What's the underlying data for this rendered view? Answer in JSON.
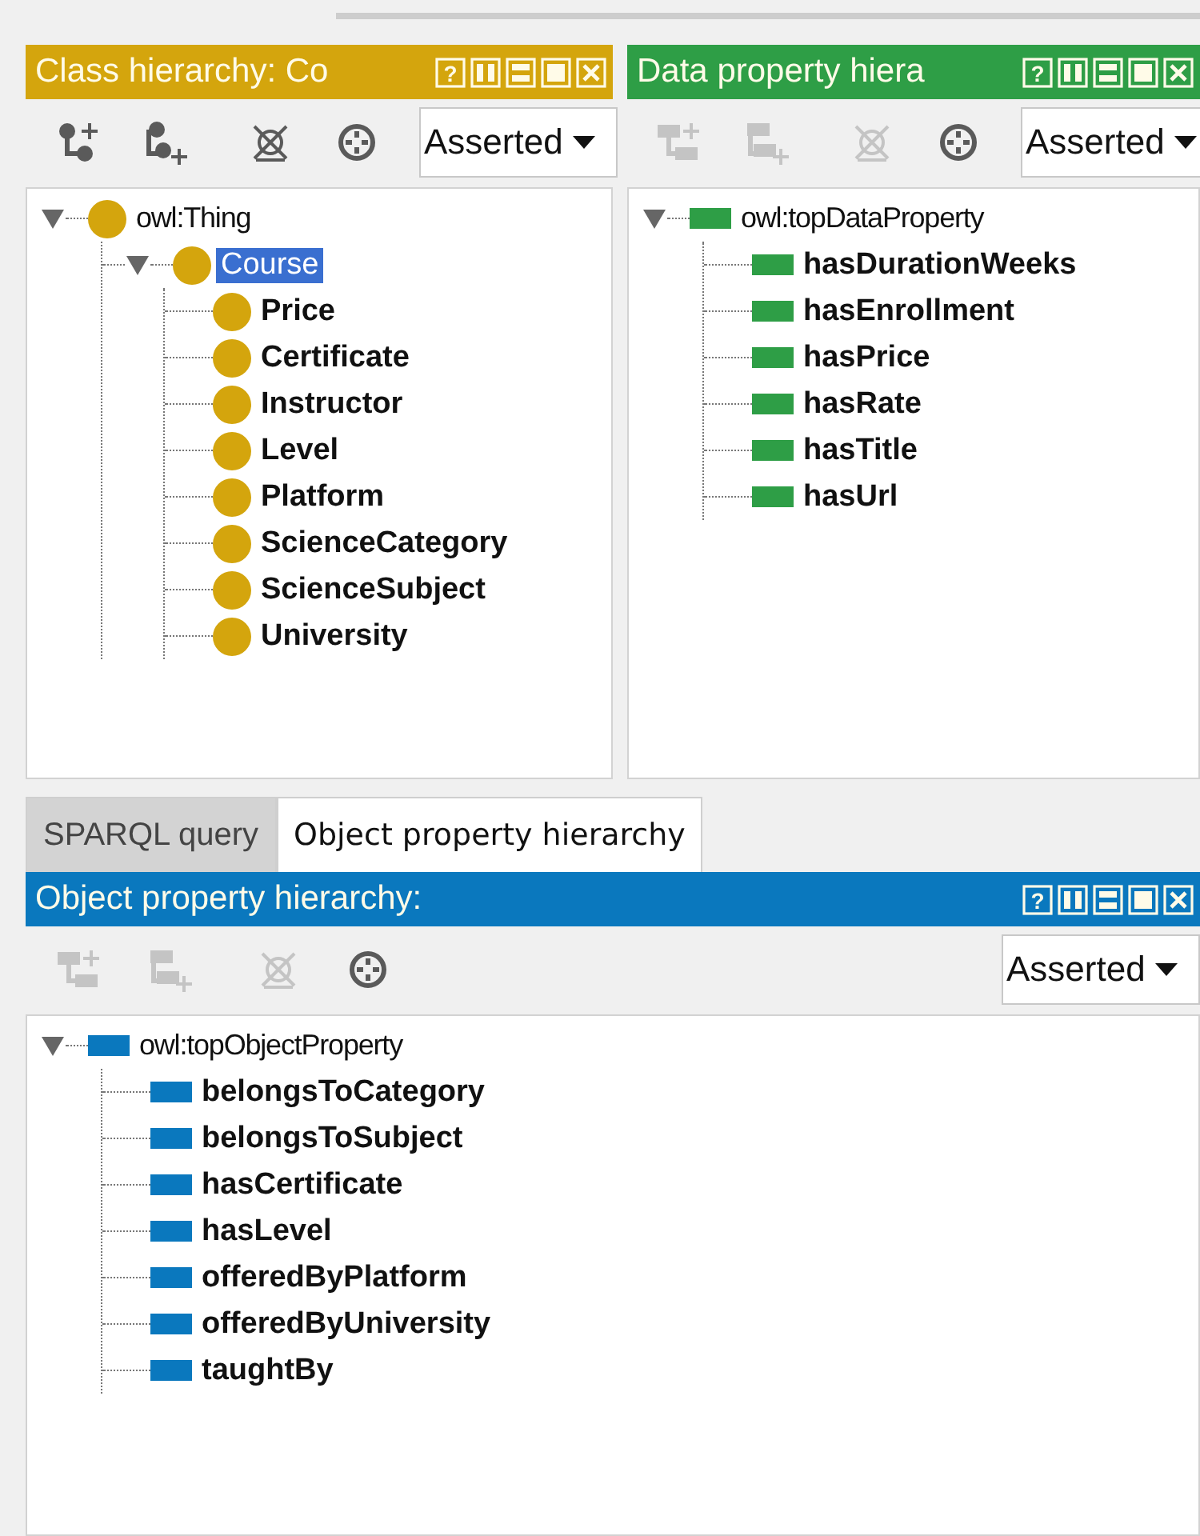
{
  "top_panels": [
    {
      "kind": "class",
      "title": "Class hierarchy: Co",
      "color": "#d4a50d",
      "help_symbol": "?",
      "view": "Asserted",
      "tools": [
        {
          "kind": "add_child",
          "disabled": false
        },
        {
          "kind": "add_sibling",
          "disabled": false
        },
        {
          "kind": "delete",
          "disabled": false
        },
        {
          "kind": "find",
          "disabled": false
        }
      ],
      "tree": [
        {
          "label": "owl:Thing",
          "bold": false,
          "selected": false,
          "expanded": true,
          "children": [
            {
              "label": "Course",
              "bold": false,
              "selected": true,
              "expanded": true,
              "children": [
                {
                  "label": "Price",
                  "bold": true,
                  "selected": false
                },
                {
                  "label": "Certificate",
                  "bold": true,
                  "selected": false
                },
                {
                  "label": "Instructor",
                  "bold": true,
                  "selected": false
                },
                {
                  "label": "Level",
                  "bold": true,
                  "selected": false
                },
                {
                  "label": "Platform",
                  "bold": true,
                  "selected": false
                },
                {
                  "label": "ScienceCategory",
                  "bold": true,
                  "selected": false
                },
                {
                  "label": "ScienceSubject",
                  "bold": true,
                  "selected": false
                },
                {
                  "label": "University",
                  "bold": true,
                  "selected": false
                }
              ]
            }
          ]
        }
      ]
    },
    {
      "kind": "property",
      "title": "Data property hiera",
      "color": "#2e9e46",
      "help_symbol": "?",
      "view": "Asserted",
      "tools": [
        {
          "kind": "add_child",
          "disabled": true
        },
        {
          "kind": "add_sibling",
          "disabled": true
        },
        {
          "kind": "delete",
          "disabled": true
        },
        {
          "kind": "find",
          "disabled": false
        }
      ],
      "tree": [
        {
          "label": "owl:topDataProperty",
          "bold": false,
          "selected": false,
          "expanded": true,
          "children": [
            {
              "label": "hasDurationWeeks",
              "bold": true,
              "selected": false
            },
            {
              "label": "hasEnrollment",
              "bold": true,
              "selected": false
            },
            {
              "label": "hasPrice",
              "bold": true,
              "selected": false
            },
            {
              "label": "hasRate",
              "bold": true,
              "selected": false
            },
            {
              "label": "hasTitle",
              "bold": true,
              "selected": false
            },
            {
              "label": "hasUrl",
              "bold": true,
              "selected": false
            }
          ]
        }
      ]
    }
  ],
  "tabs": [
    {
      "label": "SPARQL query",
      "selected": false
    },
    {
      "label": "Object property hierarchy",
      "selected": true
    }
  ],
  "bottom_panel": {
    "kind": "property",
    "title": "Object property hierarchy:",
    "color": "#0a78be",
    "help_symbol": "?",
    "view": "Asserted",
    "tools": [
      {
        "kind": "add_child",
        "disabled": true
      },
      {
        "kind": "add_sibling",
        "disabled": true
      },
      {
        "kind": "delete",
        "disabled": true
      },
      {
        "kind": "find",
        "disabled": false
      }
    ],
    "tree": [
      {
        "label": "owl:topObjectProperty",
        "bold": false,
        "selected": false,
        "expanded": true,
        "children": [
          {
            "label": "belongsToCategory",
            "bold": true,
            "selected": false
          },
          {
            "label": "belongsToSubject",
            "bold": true,
            "selected": false
          },
          {
            "label": "hasCertificate",
            "bold": true,
            "selected": false
          },
          {
            "label": "hasLevel",
            "bold": true,
            "selected": false
          },
          {
            "label": "offeredByPlatform",
            "bold": true,
            "selected": false
          },
          {
            "label": "offeredByUniversity",
            "bold": true,
            "selected": false
          },
          {
            "label": "taughtBy",
            "bold": true,
            "selected": false
          }
        ]
      }
    ]
  }
}
